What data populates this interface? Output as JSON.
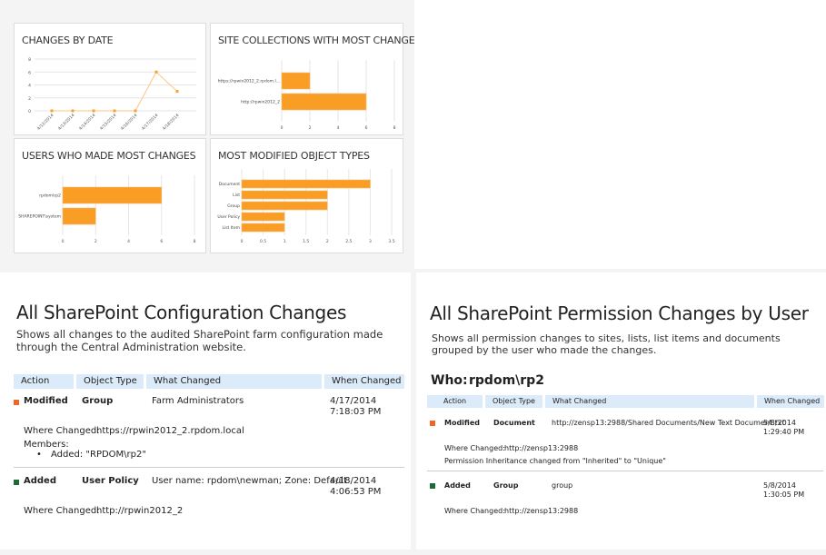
{
  "dashboard": {
    "charts": [
      {
        "title": "CHANGES BY DATE"
      },
      {
        "title": "SITE COLLECTIONS WITH MOST CHANGES"
      },
      {
        "title": "USERS WHO MADE MOST CHANGES"
      },
      {
        "title": "MOST MODIFIED OBJECT TYPES"
      }
    ]
  },
  "chart_data": [
    {
      "type": "line",
      "title": "CHANGES BY DATE",
      "categories": [
        "4/12/2014",
        "4/13/2014",
        "4/14/2014",
        "4/15/2014",
        "4/16/2014",
        "4/17/2014",
        "4/18/2014"
      ],
      "values": [
        0,
        0,
        0,
        0,
        0,
        6,
        3
      ],
      "ylim": [
        0,
        8
      ],
      "yticks": [
        "0",
        "2",
        "4",
        "6",
        "8"
      ],
      "color": "#f7a030",
      "grid": true
    },
    {
      "type": "bar",
      "orientation": "horizontal",
      "title": "SITE COLLECTIONS WITH MOST CHANGES",
      "categories": [
        "https://rpwin2012_2.rpdom.l...",
        "http://rpwin2012_2"
      ],
      "values": [
        2,
        6
      ],
      "xlim": [
        0,
        8
      ],
      "xticks": [
        "0",
        "2",
        "4",
        "6",
        "8"
      ],
      "color": "#f99d25"
    },
    {
      "type": "bar",
      "orientation": "horizontal",
      "title": "USERS WHO MADE MOST CHANGES",
      "categories": [
        "rpdom\\rp2",
        "SHAREPOINT\\system"
      ],
      "values": [
        6,
        2
      ],
      "xlim": [
        0,
        8
      ],
      "xticks": [
        "0",
        "2",
        "4",
        "6",
        "8"
      ],
      "color": "#f99d25"
    },
    {
      "type": "bar",
      "orientation": "horizontal",
      "title": "MOST MODIFIED OBJECT TYPES",
      "categories": [
        "Document",
        "List",
        "Group",
        "User Policy",
        "List Item"
      ],
      "values": [
        3,
        2,
        2,
        1,
        1
      ],
      "xlim": [
        0,
        3.5
      ],
      "xticks": [
        "0",
        "0.5",
        "1",
        "1.5",
        "2",
        "2.5",
        "3",
        "3.5"
      ],
      "color": "#f99d25"
    }
  ],
  "config": {
    "title": "All SharePoint Configuration Changes",
    "description": "Shows all changes to the audited SharePoint farm configuration made through the Central Administration website.",
    "columns": [
      "Action",
      "Object Type",
      "What Changed",
      "When Changed"
    ],
    "rows": [
      {
        "action": "Modified",
        "action_color": "#f26522",
        "object": "Group",
        "what": "Farm Administrators",
        "date": "4/17/2014",
        "time": "7:18:03 PM",
        "where_label": "Where Changed:",
        "where": "https://rpwin2012_2.rpdom.local",
        "members_label": "Members:",
        "member": "Added: \"RPDOM\\rp2\""
      },
      {
        "action": "Added",
        "action_color": "#1a6b36",
        "object": "User Policy",
        "what": "User name: rpdom\\newman; Zone: Default",
        "date": "4/18/2014",
        "time": "4:06:53 PM",
        "where_label": "Where Changed:",
        "where": "http://rpwin2012_2"
      }
    ]
  },
  "perm": {
    "title": "All SharePoint Permission Changes by User",
    "description": "Shows all permission changes to sites, lists, list items and documents grouped by the user who made the changes.",
    "who_label": "Who:",
    "who": "rpdom\\rp2",
    "columns": [
      "Action",
      "Object Type",
      "What Changed",
      "When Changed"
    ],
    "rows": [
      {
        "action": "Modified",
        "action_color": "#f26522",
        "object": "Document",
        "what": "http://zensp13:2988/Shared Documents/New Text Document.txt",
        "date": "5/8/2014",
        "time": "1:29:40 PM",
        "where_label": "Where Changed:",
        "where": "http://zensp13:2988",
        "note": "Permission Inheritance changed from \"Inherited\" to \"Unique\""
      },
      {
        "action": "Added",
        "action_color": "#1a6b36",
        "object": "Group",
        "what": "group",
        "date": "5/8/2014",
        "time": "1:30:05 PM",
        "where_label": "Where Changed:",
        "where": "http://zensp13:2988"
      }
    ]
  }
}
